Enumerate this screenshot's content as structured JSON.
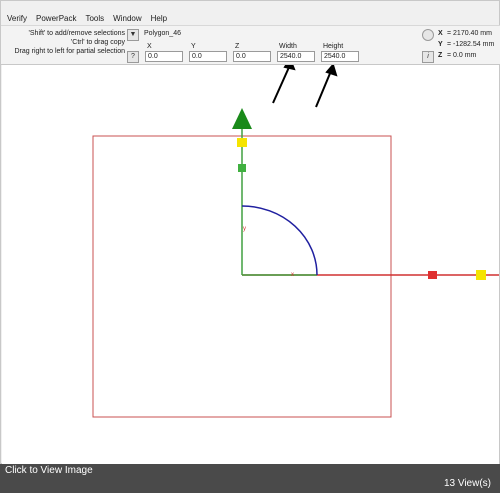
{
  "menu": [
    "Verify",
    "PowerPack",
    "Tools",
    "Window",
    "Help"
  ],
  "hints": [
    "'Shift' to add/remove selections",
    "'Ctrl' to drag copy",
    "Drag right to left for partial selection"
  ],
  "object_name": "Polygon_46",
  "fields": {
    "x": {
      "label": "X",
      "value": "0.0"
    },
    "y": {
      "label": "Y",
      "value": "0.0"
    },
    "z": {
      "label": "Z",
      "value": "0.0"
    },
    "width": {
      "label": "Width",
      "value": "2540.0"
    },
    "height": {
      "label": "Height",
      "value": "2540.0"
    }
  },
  "coords": {
    "x": {
      "label": "X",
      "value": "= 2170.40 mm"
    },
    "y": {
      "label": "Y",
      "value": "= -1282.54 mm"
    },
    "z": {
      "label": "Z",
      "value": "= 0.0 mm"
    }
  },
  "toolbar_buttons": {
    "dropdown_icon": "▼",
    "help_icon": "?",
    "info_icon": "i"
  },
  "axis_labels": {
    "x": "x",
    "y": "y"
  },
  "status": {
    "left": "Click to View Image",
    "right": "13 View(s)"
  },
  "colors": {
    "selection_box": "#c85050",
    "x_axis": "#d03030",
    "y_axis": "#40a040",
    "arc": "#2020a0",
    "handle_yellow": "#f5e400",
    "handle_green": "#40b040",
    "handle_red": "#e03030",
    "arrow_head": "#1a8a1a"
  }
}
